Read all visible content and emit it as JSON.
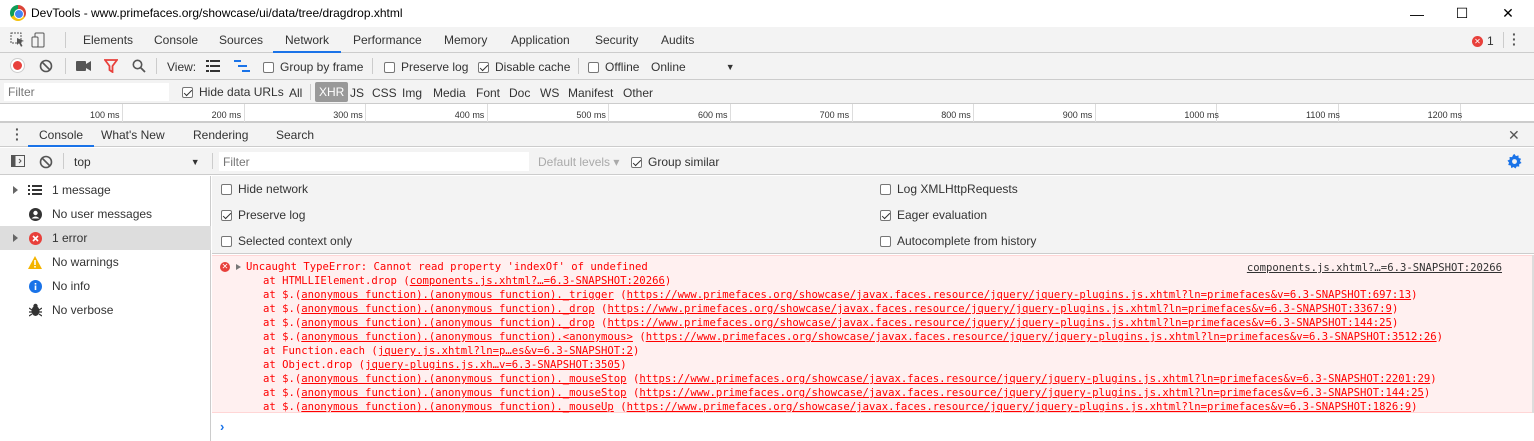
{
  "window": {
    "title": "DevTools - www.primefaces.org/showcase/ui/data/tree/dragdrop.xhtml",
    "minimize": "—",
    "maximize": "☐",
    "close": "✕"
  },
  "main_tabs": [
    "Elements",
    "Console",
    "Sources",
    "Network",
    "Performance",
    "Memory",
    "Application",
    "Security",
    "Audits"
  ],
  "error_count": "1",
  "network_toolbar": {
    "view_label": "View:",
    "group_by_frame": "Group by frame",
    "preserve_log": "Preserve log",
    "disable_cache": "Disable cache",
    "offline": "Offline",
    "throttle": "Online"
  },
  "filter_bar": {
    "placeholder": "Filter",
    "hide_data_urls": "Hide data URLs",
    "types": [
      "All",
      "XHR",
      "JS",
      "CSS",
      "Img",
      "Media",
      "Font",
      "Doc",
      "WS",
      "Manifest",
      "Other"
    ],
    "active_type": "XHR"
  },
  "timeline_ticks": [
    "100 ms",
    "200 ms",
    "300 ms",
    "400 ms",
    "500 ms",
    "600 ms",
    "700 ms",
    "800 ms",
    "900 ms",
    "1000 ms",
    "1100 ms",
    "1200 ms"
  ],
  "drawer_tabs": [
    "Console",
    "What's New",
    "Rendering",
    "Search"
  ],
  "console_toolbar": {
    "context": "top",
    "filter_placeholder": "Filter",
    "levels": "Default levels ▾",
    "group_similar": "Group similar"
  },
  "sidebar": {
    "items": [
      {
        "label": "1 message",
        "icon": "list-icon"
      },
      {
        "label": "No user messages",
        "icon": "user-icon"
      },
      {
        "label": "1 error",
        "icon": "error-icon"
      },
      {
        "label": "No warnings",
        "icon": "warning-icon"
      },
      {
        "label": "No info",
        "icon": "info-icon"
      },
      {
        "label": "No verbose",
        "icon": "bug-icon"
      }
    ]
  },
  "settings": {
    "hide_network": "Hide network",
    "preserve_log": "Preserve log",
    "selected_context_only": "Selected context only",
    "log_xhr": "Log XMLHttpRequests",
    "eager_evaluation": "Eager evaluation",
    "autocomplete": "Autocomplete from history"
  },
  "error": {
    "message": "Uncaught TypeError: Cannot read property 'indexOf' of undefined",
    "source": "components.js.xhtml?…=6.3-SNAPSHOT:20266",
    "stack": [
      {
        "pre": "at HTMLLIElement.drop (",
        "link": "components.js.xhtml?…=6.3-SNAPSHOT:20266",
        "post": ")"
      },
      {
        "pre": "at $.(",
        "fn": "anonymous function).(anonymous function)._trigger",
        "mid": " (",
        "link": "https://www.primefaces.org/showcase/javax.faces.resource/jquery/jquery-plugins.js.xhtml?ln=primefaces&v=6.3-SNAPSHOT:697:13",
        "post": ")"
      },
      {
        "pre": "at $.(",
        "fn": "anonymous function).(anonymous function)._drop",
        "mid": " (",
        "link": "https://www.primefaces.org/showcase/javax.faces.resource/jquery/jquery-plugins.js.xhtml?ln=primefaces&v=6.3-SNAPSHOT:3367:9",
        "post": ")"
      },
      {
        "pre": "at $.(",
        "fn": "anonymous function).(anonymous function)._drop",
        "mid": " (",
        "link": "https://www.primefaces.org/showcase/javax.faces.resource/jquery/jquery-plugins.js.xhtml?ln=primefaces&v=6.3-SNAPSHOT:144:25",
        "post": ")"
      },
      {
        "pre": "at $.(",
        "fn": "anonymous function).(anonymous function).<anonymous>",
        "mid": " (",
        "link": "https://www.primefaces.org/showcase/javax.faces.resource/jquery/jquery-plugins.js.xhtml?ln=primefaces&v=6.3-SNAPSHOT:3512:26",
        "post": ")"
      },
      {
        "pre": "at Function.each (",
        "link": "jquery.js.xhtml?ln=p…es&v=6.3-SNAPSHOT:2",
        "post": ")"
      },
      {
        "pre": "at Object.drop (",
        "link": "jquery-plugins.js.xh…v=6.3-SNAPSHOT:3505",
        "post": ")"
      },
      {
        "pre": "at $.(",
        "fn": "anonymous function).(anonymous function)._mouseStop",
        "mid": " (",
        "link": "https://www.primefaces.org/showcase/javax.faces.resource/jquery/jquery-plugins.js.xhtml?ln=primefaces&v=6.3-SNAPSHOT:2201:29",
        "post": ")"
      },
      {
        "pre": "at $.(",
        "fn": "anonymous function).(anonymous function)._mouseStop",
        "mid": " (",
        "link": "https://www.primefaces.org/showcase/javax.faces.resource/jquery/jquery-plugins.js.xhtml?ln=primefaces&v=6.3-SNAPSHOT:144:25",
        "post": ")"
      },
      {
        "pre": "at $.(",
        "fn": "anonymous function).(anonymous function)._mouseUp",
        "mid": " (",
        "link": "https://www.primefaces.org/showcase/javax.faces.resource/jquery/jquery-plugins.js.xhtml?ln=primefaces&v=6.3-SNAPSHOT:1826:9",
        "post": ")"
      }
    ]
  },
  "prompt": "›",
  "colors": {
    "accent": "#1a73e8",
    "error_text": "#ff0000",
    "error_bg": "#fff0f0",
    "toolbar_bg": "#f3f3f3"
  }
}
